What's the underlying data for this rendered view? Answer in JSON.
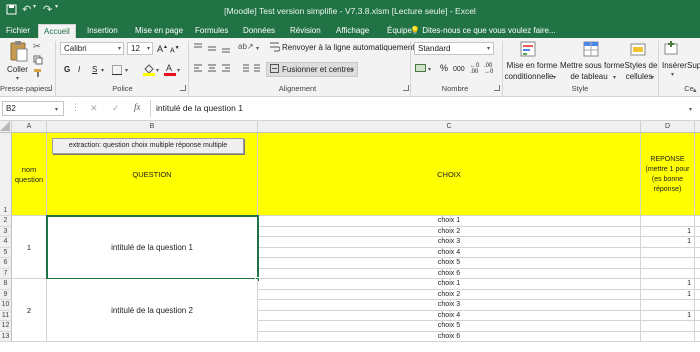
{
  "window": {
    "title": "[Moodle] Test version simplifie - V7.3.8.xlsm  [Lecture seule] - Excel"
  },
  "tabs": [
    "Fichier",
    "Accueil",
    "Insertion",
    "Mise en page",
    "Formules",
    "Données",
    "Révision",
    "Affichage",
    "Équipe"
  ],
  "tell_me": "Dites-nous ce que vous voulez faire...",
  "ribbon": {
    "clipboard": {
      "paste": "Coller",
      "label": "Presse-papiers"
    },
    "font": {
      "name": "Calibri",
      "size": "12",
      "label": "Police",
      "bold": "G",
      "italic": "I",
      "underline": "S"
    },
    "alignment": {
      "wrap": "Renvoyer à la ligne automatiquement",
      "merge": "Fusionner et centrer",
      "label": "Alignement"
    },
    "number": {
      "format": "Standard",
      "label": "Nombre",
      "percent": "%",
      "thousands": "000"
    },
    "styles": {
      "conditional_1": "Mise en forme",
      "conditional_2": "conditionnelle",
      "table_1": "Mettre sous forme",
      "table_2": "de tableau",
      "cell_1": "Styles de",
      "cell_2": "cellules",
      "label": "Style"
    },
    "cells": {
      "insert": "Insérer",
      "delete": "Sup",
      "label": "Ce"
    }
  },
  "formula_bar": {
    "name_box": "B2",
    "fx": "fx",
    "value": "intitulé de la question 1"
  },
  "columns": [
    "A",
    "B",
    "C",
    "D"
  ],
  "header_row": {
    "a": [
      "nom",
      "question"
    ],
    "b": "QUESTION",
    "button": "extraction: question choix multiple réponse multiple",
    "c": "CHOIX",
    "d": [
      "REPONSE",
      "(mettre 1 pour",
      "(es bonne",
      "réponse)"
    ]
  },
  "questions": [
    {
      "num": "1",
      "title": "intitulé de la question 1"
    },
    {
      "num": "2",
      "title": "intitulé de la question 2"
    }
  ],
  "rows": [
    {
      "row": "2",
      "choice": "choix 1",
      "answer": ""
    },
    {
      "row": "3",
      "choice": "choix 2",
      "answer": "1"
    },
    {
      "row": "4",
      "choice": "choix 3",
      "answer": "1"
    },
    {
      "row": "5",
      "choice": "choix 4",
      "answer": ""
    },
    {
      "row": "6",
      "choice": "choix 5",
      "answer": ""
    },
    {
      "row": "7",
      "choice": "choix 6",
      "answer": ""
    },
    {
      "row": "8",
      "choice": "choix 1",
      "answer": "1"
    },
    {
      "row": "9",
      "choice": "choix 2",
      "answer": "1"
    },
    {
      "row": "10",
      "choice": "choix 3",
      "answer": ""
    },
    {
      "row": "11",
      "choice": "choix 4",
      "answer": "1"
    },
    {
      "row": "12",
      "choice": "choix 5",
      "answer": ""
    },
    {
      "row": "13",
      "choice": "choix 6",
      "answer": ""
    }
  ],
  "first_row_num": "1",
  "colors": {
    "excel_green": "#217346",
    "header_yellow": "#ffff00",
    "font_red": "#e81123",
    "fill_yellow": "#ffff00"
  }
}
